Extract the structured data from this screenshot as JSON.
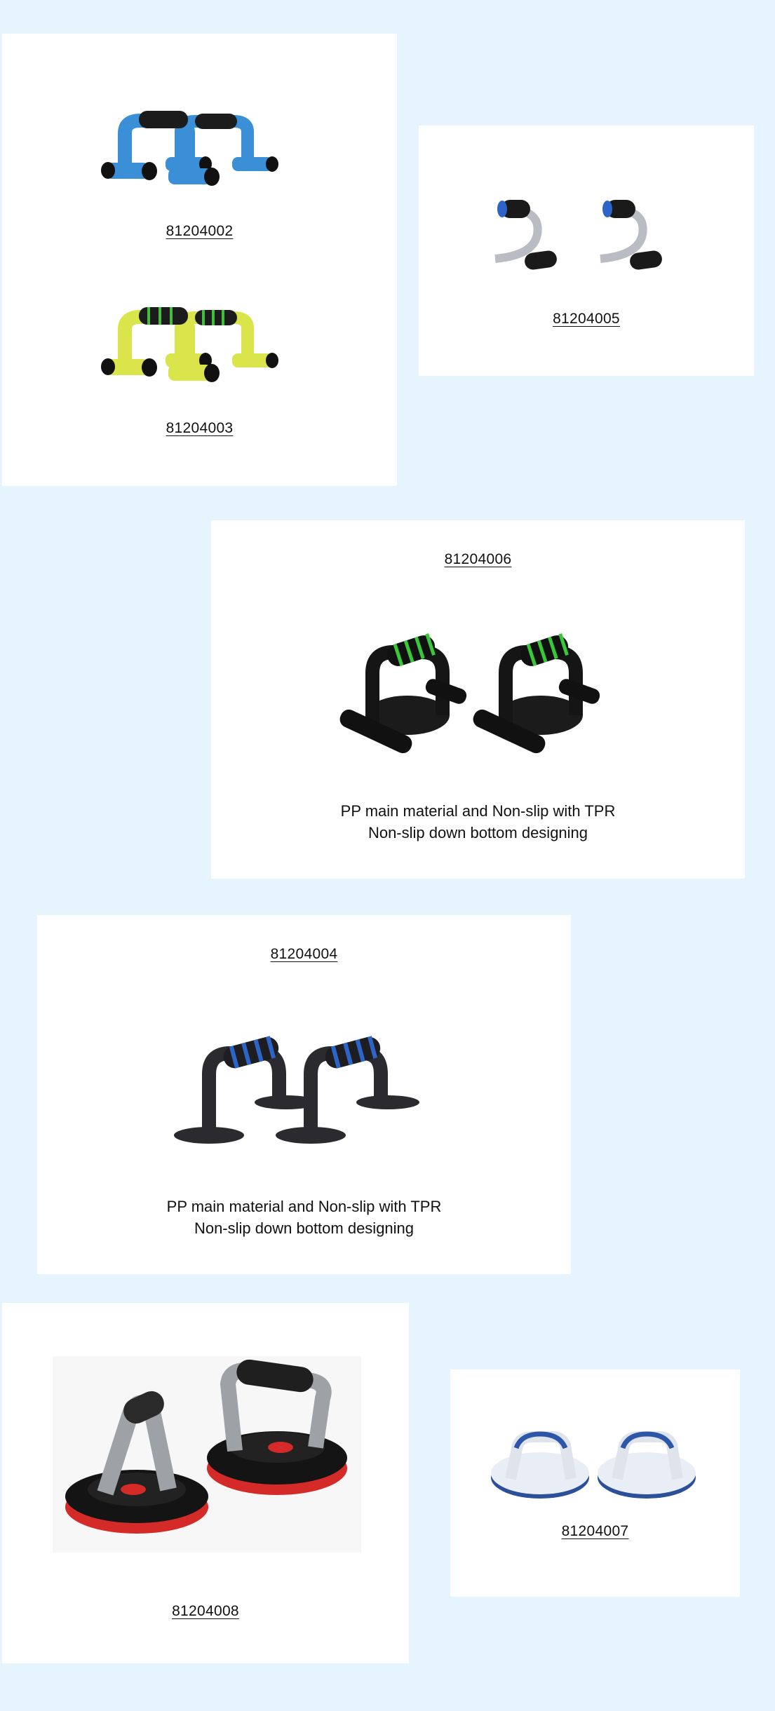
{
  "products": [
    {
      "id": "blue-foam-bar",
      "code": "81204002"
    },
    {
      "id": "yellow-foam-bar",
      "code": "81204003"
    },
    {
      "id": "s-shape-chrome",
      "code": "81204005"
    },
    {
      "id": "black-green-suction",
      "code": "81204006",
      "desc": {
        "line1": "PP main material  and  Non-slip with TPR",
        "line2": "Non-slip down bottom designing"
      }
    },
    {
      "id": "black-blue-feet",
      "code": "81204004",
      "desc": {
        "line1": "PP main material  and  Non-slip with TPR",
        "line2": "Non-slip down bottom designing"
      }
    },
    {
      "id": "rotating-red-black",
      "code": "81204008"
    },
    {
      "id": "round-white-blue",
      "code": "81204007"
    }
  ],
  "colors": {
    "background": "#e6f5fd",
    "card": "#ffffff",
    "blue_frame": "#3a8fd6",
    "yellow_frame": "#d9e54a",
    "chrome": "#b9bcc2",
    "green_grip": "#38c83a",
    "blue_grip": "#2d64c8",
    "red_base": "#d42a28"
  },
  "icons": [
    "pushup-bar-icon",
    "s-shape-pushup-icon",
    "rotating-pushup-icon",
    "round-pushup-icon"
  ]
}
